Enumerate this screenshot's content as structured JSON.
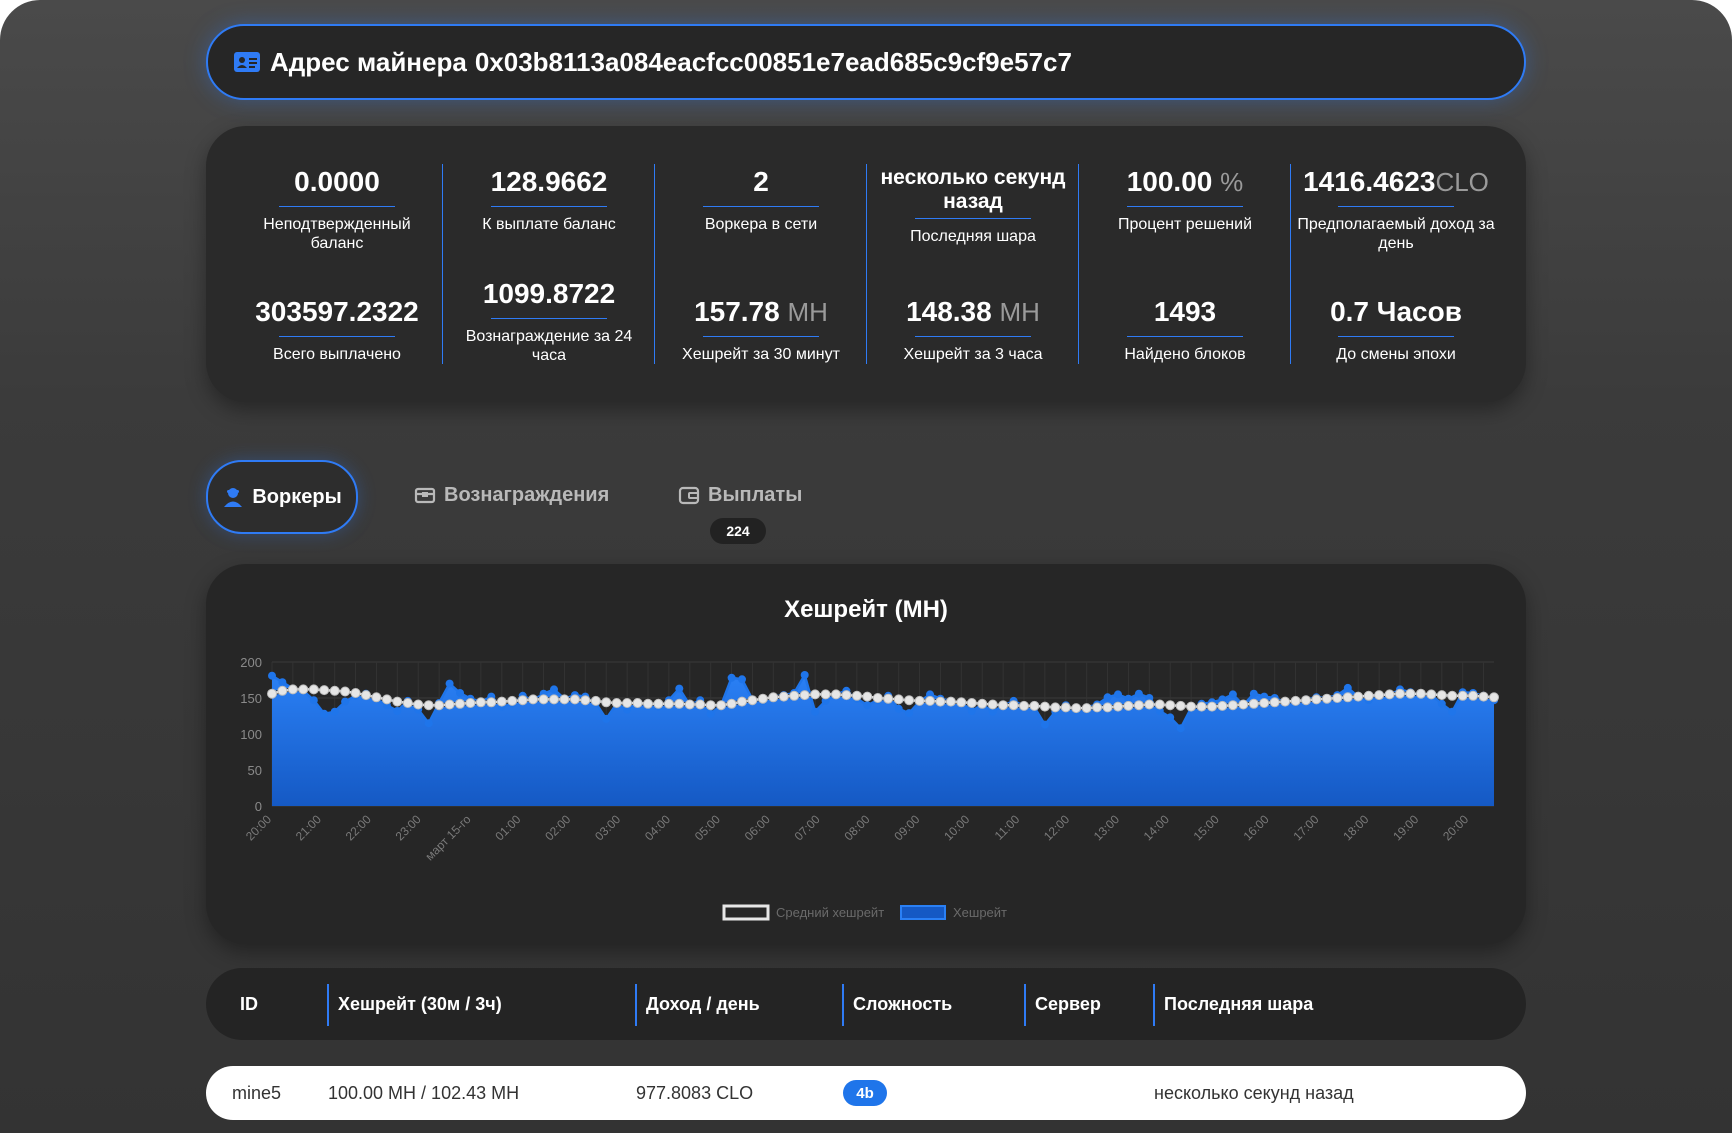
{
  "header": {
    "prefix": "Адрес майнера",
    "address": "0x03b8113a084eacfcc00851e7ead685c9cf9e57c7"
  },
  "stats": [
    {
      "value": "0.0000",
      "unit": "",
      "label": "Неподтвержденный баланс"
    },
    {
      "value": "128.9662",
      "unit": "",
      "label": "К выплате баланс"
    },
    {
      "value": "2",
      "unit": "",
      "label": "Воркера в сети"
    },
    {
      "value": "несколько секунд назад",
      "unit": "",
      "label": "Последняя шара"
    },
    {
      "value": "100.00",
      "unit": "%",
      "label": "Процент решений"
    },
    {
      "value": "1416.4623",
      "unit": "CLO",
      "label": "Предполагаемый доход за день"
    },
    {
      "value": "303597.2322",
      "unit": "",
      "label": "Всего выплачено"
    },
    {
      "value": "1099.8722",
      "unit": "",
      "label": "Вознаграждение за 24 часа"
    },
    {
      "value": "157.78",
      "unit": "MH",
      "label": "Хешрейт за 30 минут"
    },
    {
      "value": "148.38",
      "unit": "MH",
      "label": "Хешрейт за 3 часа"
    },
    {
      "value": "1493",
      "unit": "",
      "label": "Найдено блоков"
    },
    {
      "value": "0.7 Часов",
      "unit": "",
      "label": "До смены эпохи"
    }
  ],
  "tabs": [
    {
      "label": "Воркеры",
      "icon": "worker-icon",
      "active": true
    },
    {
      "label": "Вознаграждения",
      "icon": "rewards-icon",
      "active": false
    },
    {
      "label": "Выплаты",
      "icon": "wallet-icon",
      "active": false,
      "count": "224"
    }
  ],
  "chart_data": {
    "type": "area",
    "title": "Хешрейт (MH)",
    "xlabel": "",
    "ylabel": "",
    "ylim": [
      0,
      200
    ],
    "yticks": [
      0,
      50,
      100,
      150,
      200
    ],
    "x_tick_labels": [
      "20:00",
      "21:00",
      "22:00",
      "23:00",
      "март 15-го",
      "01:00",
      "02:00",
      "03:00",
      "04:00",
      "05:00",
      "06:00",
      "07:00",
      "08:00",
      "09:00",
      "10:00",
      "11:00",
      "12:00",
      "13:00",
      "14:00",
      "15:00",
      "16:00",
      "17:00",
      "18:00",
      "19:00",
      "20:00"
    ],
    "legend": [
      "Средний хешрейт",
      "Хешрейт"
    ],
    "legend_position": "bottom",
    "grid": true,
    "colors": {
      "hashrate": "#1f75ea",
      "average": "#e6e6e6"
    },
    "series": [
      {
        "name": "Хешрейт",
        "values": [
          181,
          172,
          163,
          160,
          147,
          128,
          131,
          145,
          153,
          156,
          149,
          140,
          132,
          146,
          134,
          115,
          143,
          170,
          157,
          149,
          145,
          152,
          138,
          142,
          153,
          147,
          156,
          162,
          149,
          154,
          152,
          143,
          121,
          142,
          134,
          143,
          142,
          138,
          147,
          163,
          140,
          147,
          128,
          140,
          178,
          176,
          148,
          146,
          152,
          154,
          157,
          182,
          131,
          146,
          155,
          160,
          149,
          140,
          147,
          153,
          135,
          129,
          145,
          155,
          149,
          146,
          144,
          132,
          141,
          131,
          139,
          146,
          139,
          137,
          113,
          131,
          140,
          133,
          137,
          141,
          151,
          155,
          149,
          156,
          150,
          132,
          123,
          108,
          136,
          142,
          144,
          148,
          155,
          140,
          156,
          152,
          150,
          144,
          144,
          148,
          151,
          150,
          154,
          164,
          152,
          147,
          152,
          154,
          162,
          158,
          155,
          154,
          142,
          131,
          158,
          157,
          153,
          147
        ]
      },
      {
        "name": "Средний хешрейт",
        "values": [
          156,
          160,
          162,
          162,
          162,
          161,
          160,
          159,
          157,
          154,
          151,
          148,
          145,
          143,
          141,
          140,
          140,
          141,
          142,
          143,
          144,
          144,
          145,
          146,
          147,
          148,
          148,
          148,
          148,
          148,
          147,
          146,
          144,
          143,
          143,
          143,
          142,
          142,
          142,
          142,
          141,
          141,
          140,
          140,
          142,
          145,
          147,
          149,
          151,
          152,
          153,
          154,
          155,
          155,
          155,
          154,
          153,
          152,
          150,
          149,
          148,
          147,
          146,
          146,
          145,
          145,
          144,
          143,
          142,
          141,
          140,
          140,
          139,
          139,
          138,
          137,
          137,
          136,
          136,
          137,
          137,
          138,
          139,
          140,
          141,
          141,
          140,
          139,
          138,
          138,
          138,
          139,
          140,
          141,
          142,
          143,
          144,
          145,
          146,
          147,
          148,
          149,
          150,
          151,
          152,
          153,
          154,
          155,
          156,
          156,
          156,
          155,
          154,
          153,
          153,
          153,
          152,
          151
        ]
      }
    ]
  },
  "table": {
    "headers": [
      "ID",
      "Хешрейт (30м / 3ч)",
      "Доход / день",
      "Сложность",
      "Сервер",
      "Последняя шара"
    ],
    "rows": [
      {
        "id": "mine5",
        "hashrate": "100.00 MH / 102.43 MH",
        "income": "977.8083 CLO",
        "difficulty": "4b",
        "server": "",
        "last_share": "несколько секунд назад"
      }
    ]
  }
}
